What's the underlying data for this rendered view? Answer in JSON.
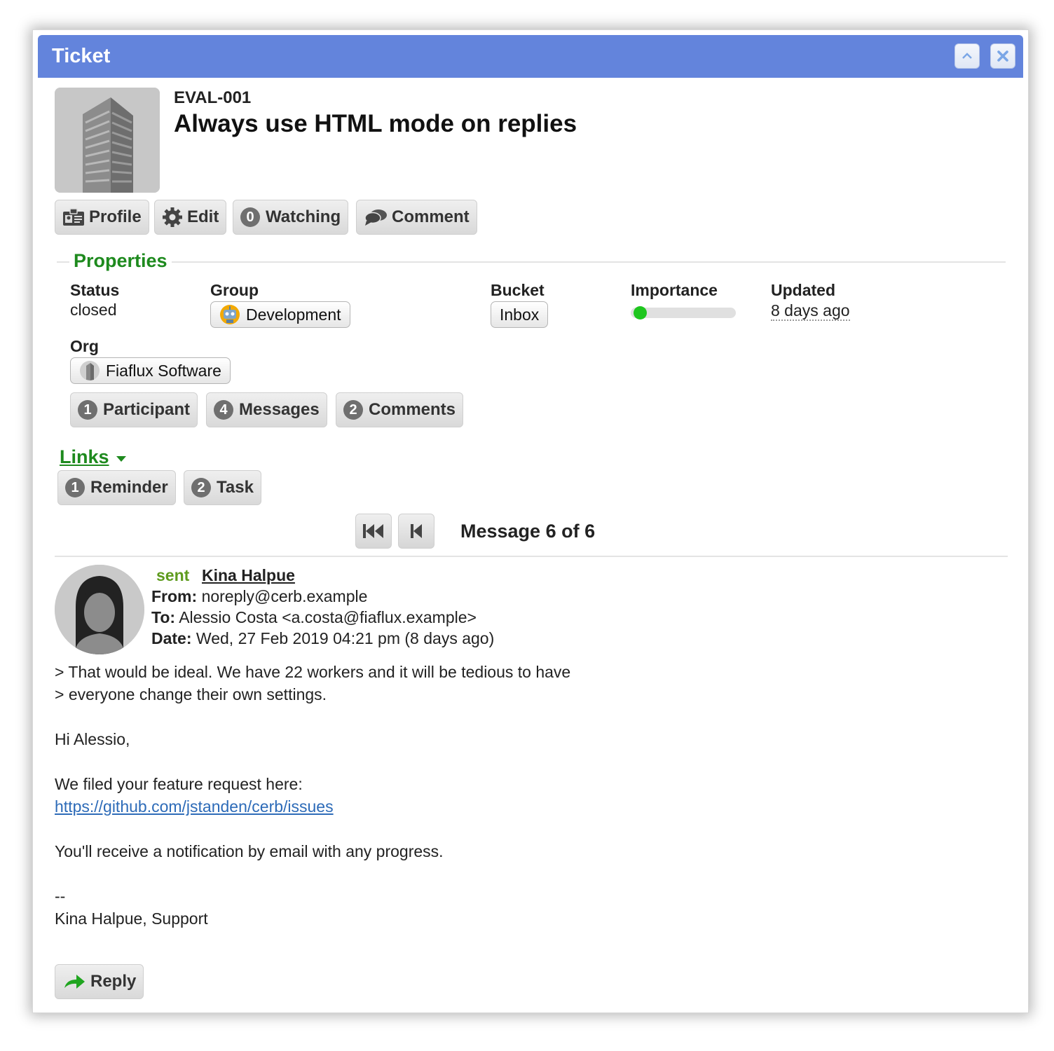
{
  "window": {
    "title": "Ticket"
  },
  "ticket": {
    "mask": "EVAL-001",
    "subject": "Always use HTML mode on replies"
  },
  "toolbar": {
    "profile_label": "Profile",
    "edit_label": "Edit",
    "watching_count": "0",
    "watching_label": "Watching",
    "comment_label": "Comment"
  },
  "properties": {
    "legend": "Properties",
    "status_label": "Status",
    "status_value": "closed",
    "group_label": "Group",
    "group_value": "Development",
    "bucket_label": "Bucket",
    "bucket_value": "Inbox",
    "importance_label": "Importance",
    "importance_level": 0.0,
    "updated_label": "Updated",
    "updated_value": "8 days ago",
    "org_label": "Org",
    "org_value": "Fiaflux Software"
  },
  "counts": [
    {
      "count": "1",
      "label": "Participant"
    },
    {
      "count": "4",
      "label": "Messages"
    },
    {
      "count": "2",
      "label": "Comments"
    }
  ],
  "links": {
    "label": "Links",
    "items": [
      {
        "count": "1",
        "label": "Reminder"
      },
      {
        "count": "2",
        "label": "Task"
      }
    ]
  },
  "pager": {
    "counter": "Message 6 of 6"
  },
  "message": {
    "sent_label": "sent",
    "sender": "Kina Halpue",
    "from_label": "From:",
    "from_value": "noreply@cerb.example",
    "to_label": "To:",
    "to_value": "Alessio Costa <a.costa@fiaflux.example>",
    "date_label": "Date:",
    "date_value": "Wed, 27 Feb 2019 04:21 pm (8 days ago)",
    "body": {
      "quote1": "> That would be ideal. We have 22 workers and it will be tedious to have",
      "quote2": "> everyone change their own settings.",
      "greeting": "Hi Alessio,",
      "line1": "We filed your feature request here:",
      "url": "https://github.com/jstanden/cerb/issues",
      "line2": "You'll receive a notification by email with any progress.",
      "sig_dash": "--",
      "signature": "Kina Halpue, Support"
    },
    "reply_label": "Reply"
  },
  "colors": {
    "titlebar": "#6384dc",
    "section_green": "#1e8a1e",
    "importance_dot": "#1ec61e",
    "link_blue": "#2d6bb8"
  }
}
